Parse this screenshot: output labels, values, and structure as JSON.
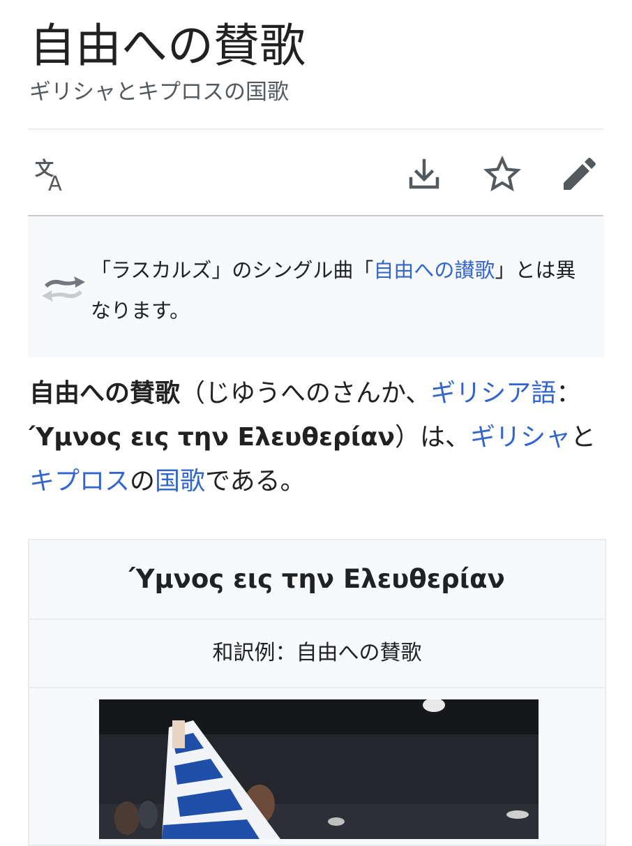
{
  "page": {
    "title": "自由への賛歌",
    "subtitle": "ギリシャとキプロスの国歌"
  },
  "toolbar": {
    "language_icon": "translate-icon",
    "download_icon": "download-icon",
    "watch_icon": "star-icon",
    "edit_icon": "pencil-icon"
  },
  "hatnote": {
    "icon": "swap-arrows-icon",
    "text_before": "「ラスカルズ」のシングル曲「",
    "link": "自由への讃歌",
    "text_after": "」とは異なります。"
  },
  "lead": {
    "bold_title": "自由への賛歌",
    "reading": "（じゆうへのさんか、",
    "lang_link": "ギリシア語",
    "colon": "：",
    "greek_bold": "Ύμνος εις την Ελευθερίαν",
    "after_greek": "）は、",
    "link_greece": "ギリシャ",
    "and": "と",
    "link_cyprus": "キプロス",
    "no": "の",
    "link_anthem": "国歌",
    "end": "である。"
  },
  "infobox": {
    "title": "Ύμνος εις την Ελευθερίαν",
    "subtitle": "和訳例：自由への賛歌"
  },
  "colors": {
    "link": "#3366cc",
    "text": "#202122",
    "muted": "#54595d",
    "icon": "#54595d",
    "box_bg": "#f8f9fa",
    "border": "#eaecf0"
  }
}
